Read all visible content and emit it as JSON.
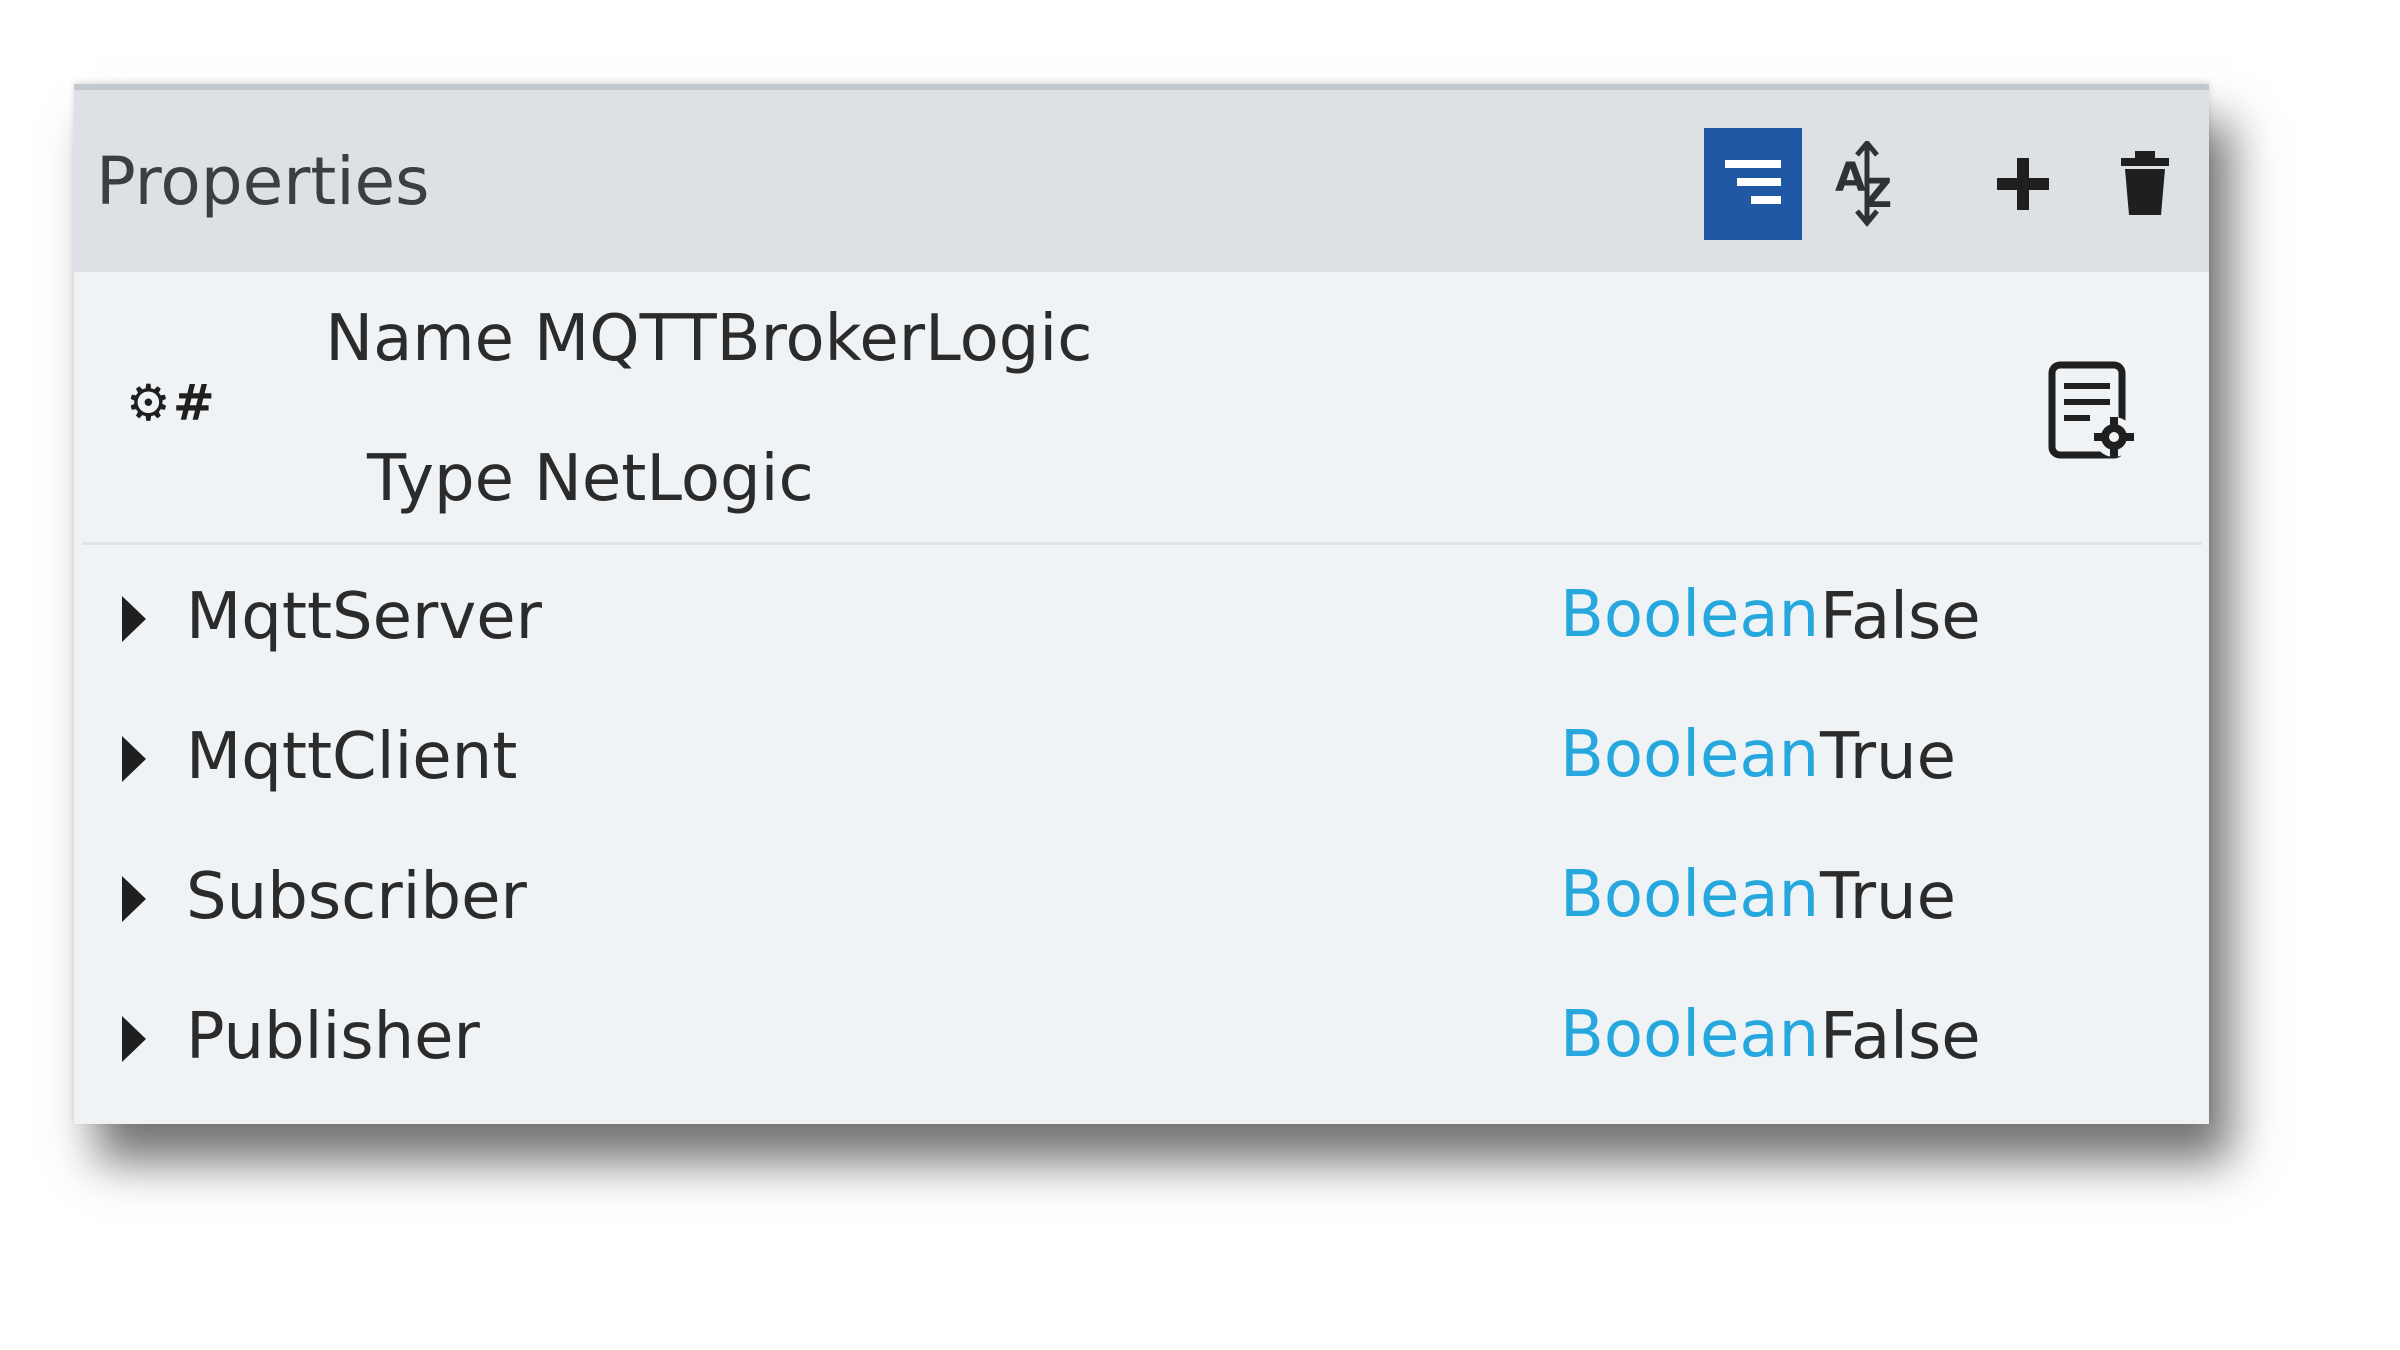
{
  "panel": {
    "title": "Properties",
    "toolbar": {
      "filter_icon": "filter-lines-icon",
      "sort_icon": "sort-az-icon",
      "add_icon": "plus-icon",
      "delete_icon": "trash-icon",
      "active_color": "#2158a6"
    }
  },
  "meta": {
    "icon": "gear-hash-icon",
    "icon_text": "⚙#",
    "name_label": "Name",
    "name_value": "MQTTBrokerLogic",
    "type_label": "Type",
    "type_value": "NetLogic",
    "config_icon": "document-gear-icon"
  },
  "properties": [
    {
      "name": "MqttServer",
      "type": "Boolean",
      "value": "False"
    },
    {
      "name": "MqttClient",
      "type": "Boolean",
      "value": "True"
    },
    {
      "name": "Subscriber",
      "type": "Boolean",
      "value": "True"
    },
    {
      "name": "Publisher",
      "type": "Boolean",
      "value": "False"
    }
  ],
  "colors": {
    "type_text": "#26a8df",
    "header_bg": "#dde1e6",
    "panel_bg": "#f0f3f6"
  }
}
